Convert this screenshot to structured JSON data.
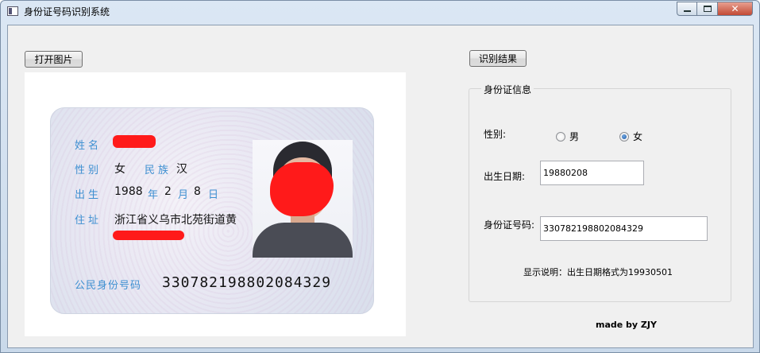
{
  "window": {
    "title": "身份证号码识别系统"
  },
  "toolbar": {
    "open_label": "打开图片",
    "recognize_label": "识别结果"
  },
  "card": {
    "name_label": "姓名",
    "gender_label": "性别",
    "gender_value": "女",
    "ethnicity_label": "民族",
    "ethnicity_value": "汉",
    "birth_label": "出生",
    "birth_year": "1988",
    "birth_year_unit": "年",
    "birth_month": "2",
    "birth_month_unit": "月",
    "birth_day": "8",
    "birth_day_unit": "日",
    "address_label": "住址",
    "address_value": "浙江省义乌市北苑街道黄",
    "id_label": "公民身份号码",
    "id_value": "330782198802084329"
  },
  "info": {
    "group_title": "身份证信息",
    "gender_label": "性别:",
    "gender_options": [
      "男",
      "女"
    ],
    "gender_selected": "女",
    "birth_label": "出生日期:",
    "birth_value": "19880208",
    "id_label": "身份证号码:",
    "id_value": "330782198802084329",
    "hint": "显示说明：出生日期格式为19930501"
  },
  "footer": {
    "credit": "made by ZJY"
  },
  "colors": {
    "redaction": "#ff1a1a",
    "card_label": "#3d8fd1",
    "radio_selected": "#1f5aa8"
  },
  "icons": {
    "app": "app-window-icon",
    "minimize": "minimize-icon",
    "maximize": "maximize-icon",
    "close": "close-icon"
  }
}
